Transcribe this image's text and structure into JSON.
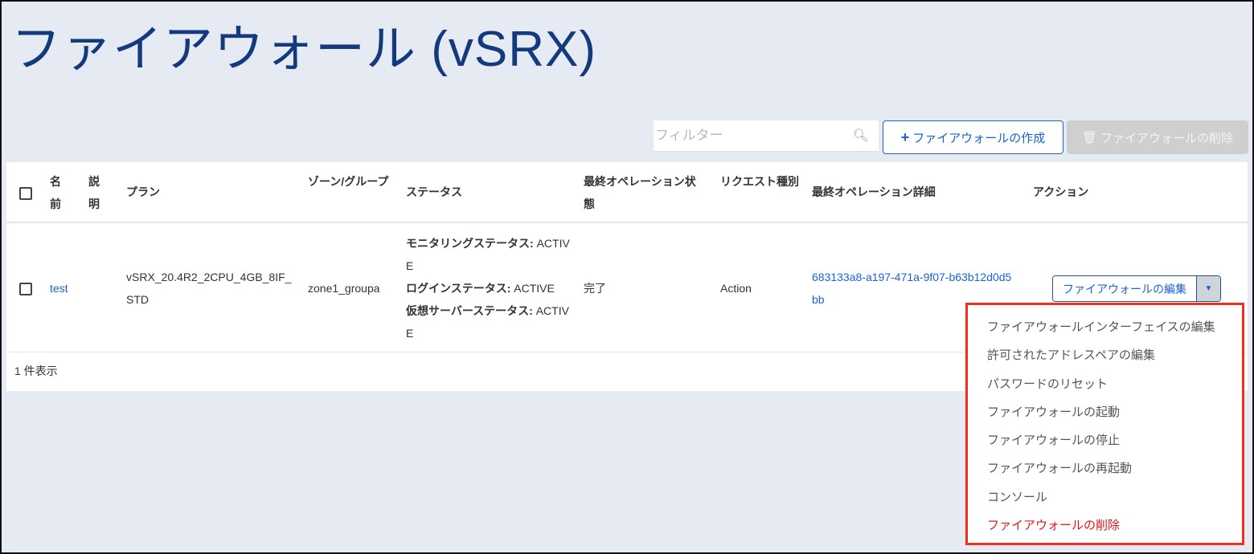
{
  "title": "ファイアウォール (vSRX)",
  "toolbar": {
    "filter_placeholder": "フィルター",
    "create_label": "ファイアウォールの作成",
    "delete_label": "ファイアウォールの削除"
  },
  "table": {
    "headers": {
      "name": "名前",
      "description": "説明",
      "plan": "プラン",
      "zone": "ゾーン/グループ",
      "status": "ステータス",
      "last_op_state": "最終オペレーション状態",
      "request_type": "リクエスト種別",
      "last_op_detail": "最終オペレーション詳細",
      "action": "アクション"
    },
    "rows": [
      {
        "name": "test",
        "description": "",
        "plan": "vSRX_20.4R2_2CPU_4GB_8IF_STD",
        "zone": "zone1_groupa",
        "status": [
          {
            "label": "モニタリングステータス:",
            "value": "ACTIVE"
          },
          {
            "label": "ログインステータス:",
            "value": "ACTIVE"
          },
          {
            "label": "仮想サーバーステータス:",
            "value": "ACTIVE"
          }
        ],
        "last_op_state": "完了",
        "request_type": "Action",
        "last_op_detail": "683133a8-a197-471a-9f07-b63b12d0d5bb",
        "action_label": "ファイアウォールの編集"
      }
    ],
    "footer": "1 件表示"
  },
  "menu": [
    "ファイアウォールインターフェイスの編集",
    "許可されたアドレスペアの編集",
    "パスワードのリセット",
    "ファイアウォールの起動",
    "ファイアウォールの停止",
    "ファイアウォールの再起動",
    "コンソール",
    "ファイアウォールの削除"
  ],
  "colors": {
    "title": "#133a7c",
    "link": "#1a62d6",
    "danger": "#e8141e",
    "menu_border": "#f0301c"
  }
}
